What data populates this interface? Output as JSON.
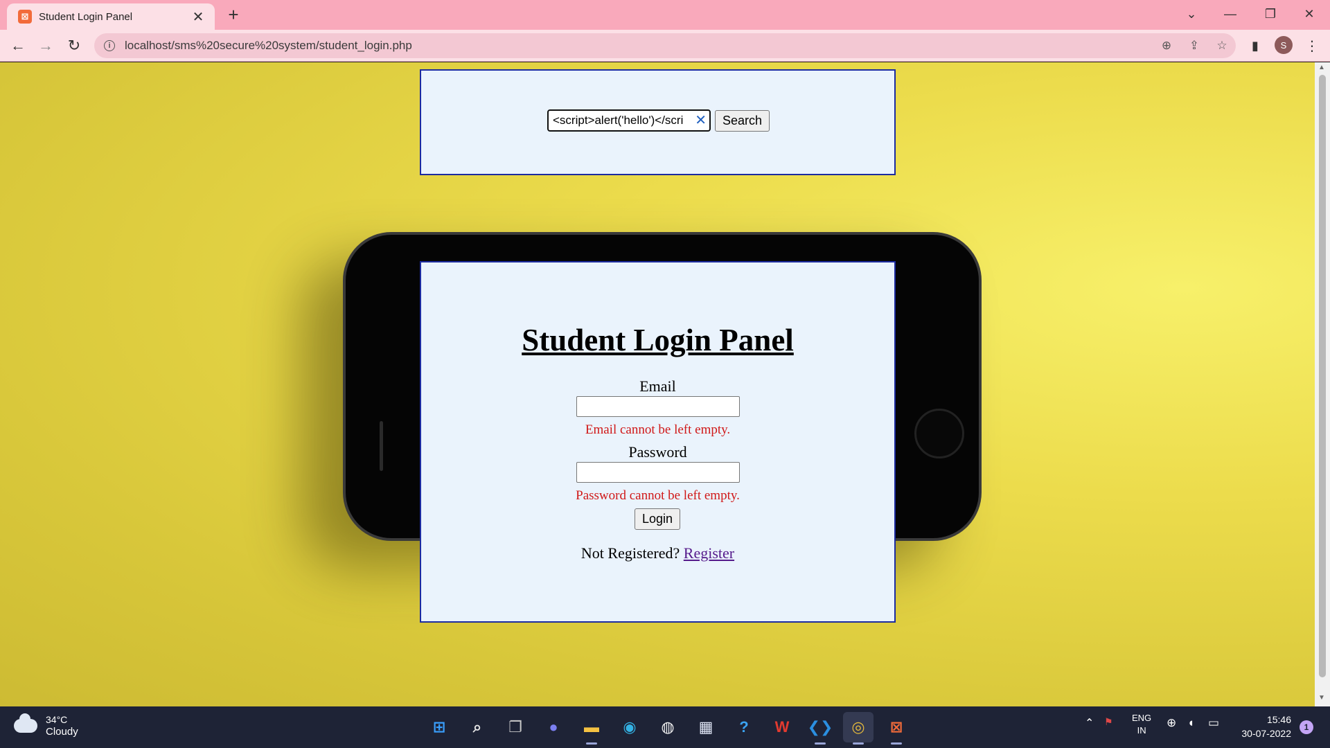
{
  "browser": {
    "tab_title": "Student Login Panel",
    "tab_favicon": "xampp-icon",
    "url": "localhost/sms%20secure%20system/student_login.php",
    "profile_initial": "S"
  },
  "search": {
    "value": "<script>alert('hello')</scri",
    "button_label": "Search"
  },
  "login": {
    "title": "Student Login Panel",
    "email_label": "Email",
    "email_error": "Email cannot be left empty.",
    "password_label": "Password",
    "password_error": "Password cannot be left empty.",
    "login_label": "Login",
    "register_prompt": "Not Registered?",
    "register_link": "Register"
  },
  "taskbar": {
    "temperature": "34°C",
    "condition": "Cloudy",
    "lang_top": "ENG",
    "lang_bottom": "IN",
    "time": "15:46",
    "date": "30-07-2022",
    "notifications": "1"
  },
  "colors": {
    "tab_bar": "#f9a9bb",
    "panel_bg": "#eaf3fc",
    "panel_border": "#1c2ba0",
    "error": "#d01818",
    "link_visited": "#551a8b"
  }
}
